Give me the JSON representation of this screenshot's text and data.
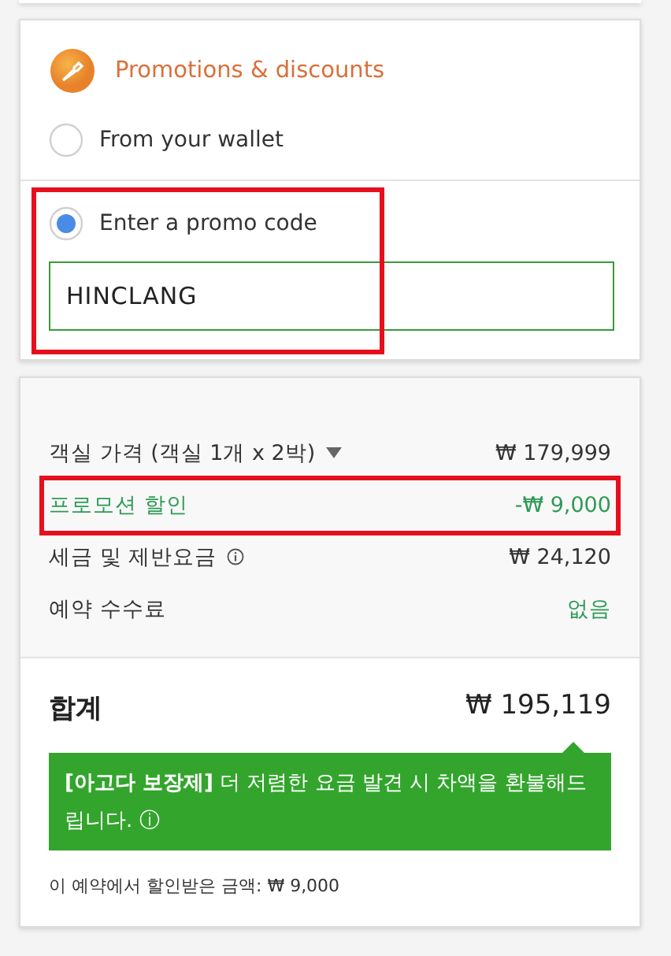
{
  "promotions": {
    "title": "Promotions & discounts",
    "options": [
      {
        "label": "From your wallet",
        "selected": false,
        "highlighted": false
      },
      {
        "label": "Enter a promo code",
        "selected": true,
        "highlighted": true,
        "value": "HINCLANG"
      }
    ]
  },
  "price": {
    "rows": [
      {
        "kind": "charge",
        "label": "객실 가격 (객실 1개 x 2박)",
        "value": "₩ 179,999",
        "dropdown": true,
        "info": false,
        "highlighted": false
      },
      {
        "kind": "discount",
        "label": "프로모션 할인",
        "value": "-₩ 9,000",
        "dropdown": false,
        "info": false,
        "highlighted": true
      },
      {
        "kind": "charge",
        "label": "세금 및 제반요금",
        "value": "₩ 24,120",
        "dropdown": false,
        "info": true,
        "highlighted": false
      },
      {
        "kind": "free",
        "label": "예약 수수료",
        "value": "없음",
        "dropdown": false,
        "info": false,
        "highlighted": false
      }
    ],
    "total": {
      "label": "합계",
      "value": "₩ 195,119"
    },
    "guarantee": "**[아고다 보장제]** 더 저렴한 요금 발견 시 차액을 환불해드립니다. ⓘ",
    "savings": "이 예약에서 할인받은 금액: ₩ 9,000"
  }
}
